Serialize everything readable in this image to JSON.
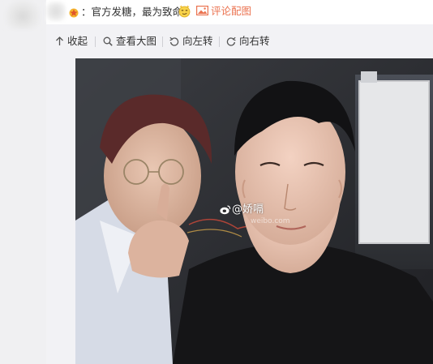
{
  "post": {
    "text": "：官方发糖，最为致命",
    "comment_pic_label": "评论配图"
  },
  "toolbar": {
    "collapse_label": "收起",
    "view_large_label": "查看大图",
    "rotate_left_label": "向左转",
    "rotate_right_label": "向右转"
  },
  "photo": {
    "watermark": "@娇嗝",
    "watermark_url": "weibo.com"
  },
  "colors": {
    "accent_link": "#eb7350",
    "panel_bg": "#f2f2f5"
  },
  "icons": [
    "gold-badge-icon",
    "smirk-emoji-icon",
    "picture-icon",
    "collapse-arrow-icon",
    "magnifier-icon",
    "rotate-left-icon",
    "rotate-right-icon",
    "weibo-logo-icon"
  ]
}
